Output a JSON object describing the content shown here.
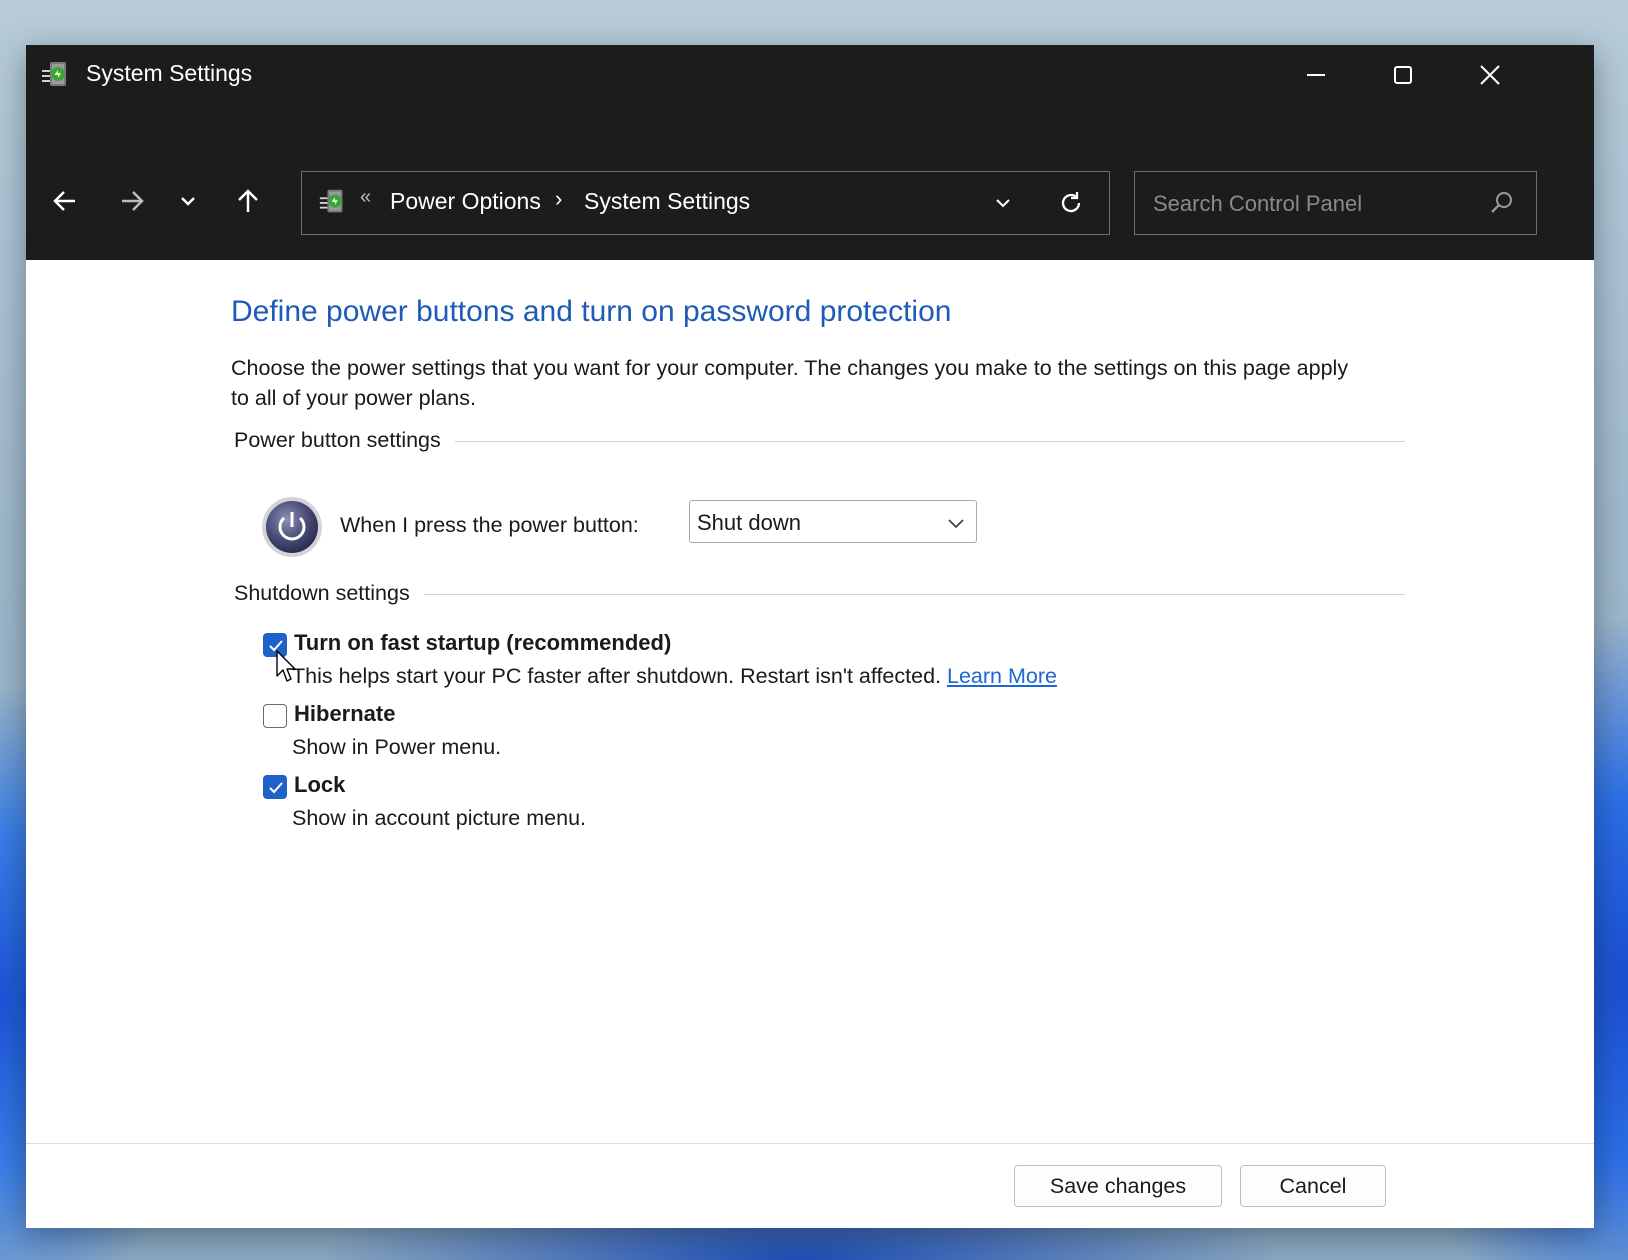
{
  "window": {
    "title": "System Settings"
  },
  "address_bar": {
    "overflow_chevron": "«",
    "breadcrumbs": [
      "Power Options",
      "System Settings"
    ],
    "separator": "›"
  },
  "search": {
    "placeholder": "Search Control Panel",
    "value": ""
  },
  "main": {
    "title": "Define power buttons and turn on password protection",
    "description": "Choose the power settings that you want for your computer. The changes you make to the settings on this page apply to all of your power plans.",
    "power_button_group": {
      "label": "Power button settings",
      "prompt": "When I press the power button:",
      "selected_action": "Shut down"
    },
    "shutdown_group": {
      "label": "Shutdown settings",
      "options": [
        {
          "title": "Turn on fast startup (recommended)",
          "description": "This helps start your PC faster after shutdown. Restart isn't affected.",
          "link": "Learn More",
          "checked": true
        },
        {
          "title": "Hibernate",
          "description": "Show in Power menu.",
          "checked": false
        },
        {
          "title": "Lock",
          "description": "Show in account picture menu.",
          "checked": true
        }
      ]
    }
  },
  "footer": {
    "save_label": "Save changes",
    "cancel_label": "Cancel"
  },
  "colors": {
    "title_bar": "#1c1c1c",
    "heading_blue": "#1d5bb6",
    "link_blue": "#1c66d6",
    "checkbox_blue": "#1f62c7"
  },
  "icons": {
    "app": "control-panel-power-icon",
    "minimize": "minimize-icon",
    "maximize": "maximize-icon",
    "close": "close-icon",
    "back": "arrow-left-icon",
    "forward": "arrow-right-icon",
    "recent": "chevron-down-icon",
    "up": "arrow-up-icon",
    "refresh": "refresh-icon",
    "search": "search-icon",
    "power": "power-icon"
  }
}
